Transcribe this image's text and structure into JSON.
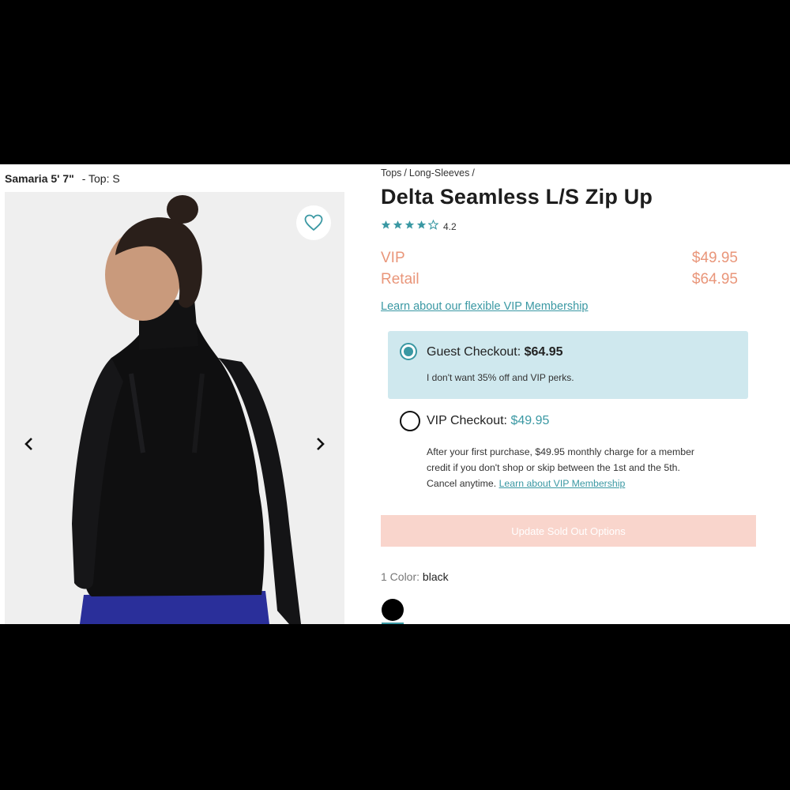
{
  "model": {
    "name": "Samaria 5' 7\"",
    "size_label": "- Top: S"
  },
  "breadcrumb": [
    "Tops",
    "Long-Sleeves"
  ],
  "breadcrumb_sep": "/",
  "product": {
    "title": "Delta Seamless L/S Zip Up",
    "rating": "4.2",
    "rating_stars": 4.2
  },
  "prices": {
    "vip_label": "VIP",
    "vip_price": "$49.95",
    "retail_label": "Retail",
    "retail_price": "$64.95"
  },
  "learn_link": "Learn about our flexible VIP Membership",
  "checkout": {
    "guest": {
      "label": "Guest Checkout:",
      "amount": "$64.95",
      "subtext": "I don't want 35% off and VIP perks.",
      "selected": true
    },
    "vip": {
      "label": "VIP Checkout:",
      "amount": "$49.95",
      "desc": "After your first purchase, $49.95 monthly charge for a member credit if you don't shop or skip between the 1st and the 5th. Cancel anytime.",
      "link": "Learn about VIP Membership",
      "selected": false
    }
  },
  "cta_label": "Update Sold Out Options",
  "color": {
    "count_label": "1 Color:",
    "value": "black"
  },
  "colors": {
    "accent": "#3a98a3",
    "price": "#e9967a",
    "guest_bg": "#cfe8ee",
    "cta_bg": "#f9d5cc",
    "swatch": "#000000"
  },
  "icons": {
    "favorite": "heart-outline-icon",
    "prev": "chevron-left-icon",
    "next": "chevron-right-icon",
    "star": "star-icon"
  }
}
